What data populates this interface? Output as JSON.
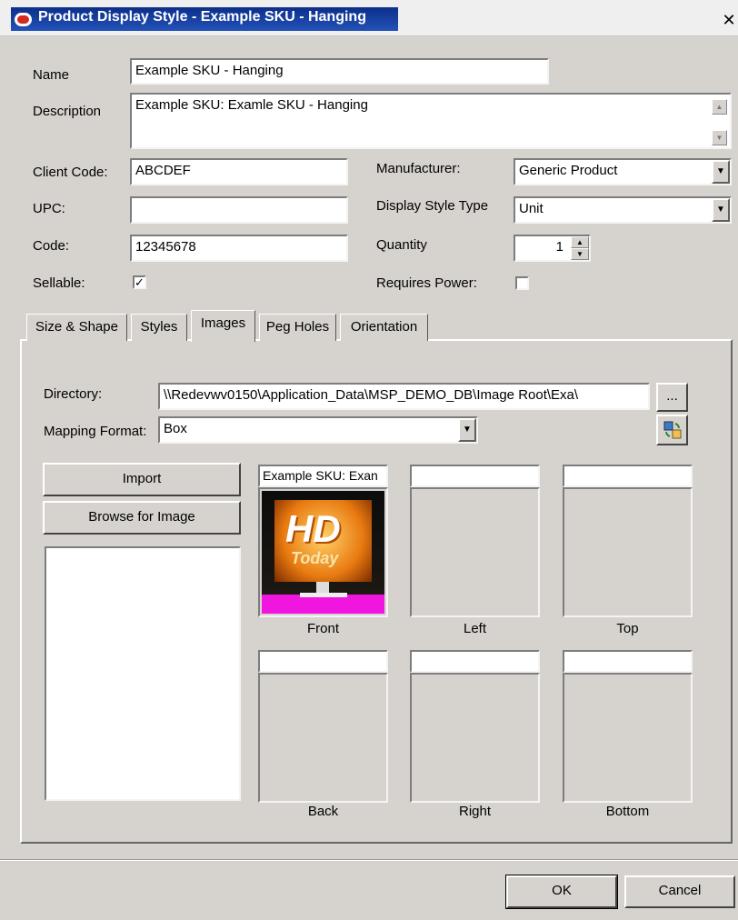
{
  "window": {
    "title": "Product Display Style - Example SKU - Hanging",
    "close_glyph": "✕"
  },
  "form": {
    "name_label": "Name",
    "name_value": "Example SKU - Hanging",
    "description_label": "Description",
    "description_value": "Example SKU: Examle SKU - Hanging",
    "client_code_label": "Client Code:",
    "client_code_value": "ABCDEF",
    "upc_label": "UPC:",
    "upc_value": "",
    "code_label": "Code:",
    "code_value": "12345678",
    "sellable_label": "Sellable:",
    "sellable_checked": true,
    "manufacturer_label": "Manufacturer:",
    "manufacturer_value": "Generic Product",
    "display_style_type_label": "Display Style Type",
    "display_style_type_value": "Unit",
    "quantity_label": "Quantity",
    "quantity_value": "1",
    "requires_power_label": "Requires Power:",
    "requires_power_checked": false
  },
  "tabs": [
    {
      "label": "Size & Shape"
    },
    {
      "label": "Styles"
    },
    {
      "label": "Images",
      "active": true
    },
    {
      "label": "Peg Holes"
    },
    {
      "label": "Orientation"
    }
  ],
  "images_tab": {
    "directory_label": "Directory:",
    "directory_value": "\\\\Redevwv0150\\Application_Data\\MSP_DEMO_DB\\Image Root\\Exa\\",
    "browse_dir_label": "...",
    "mapping_format_label": "Mapping Format:",
    "mapping_format_value": "Box",
    "import_label": "Import",
    "browse_image_label": "Browse for Image",
    "thumb_text_top": "HD",
    "thumb_text_bottom": "Today",
    "faces": [
      {
        "label": "Front",
        "caption": "Example SKU: Exan",
        "has_image": true
      },
      {
        "label": "Left",
        "caption": "",
        "has_image": false
      },
      {
        "label": "Top",
        "caption": "",
        "has_image": false
      },
      {
        "label": "Back",
        "caption": "",
        "has_image": false
      },
      {
        "label": "Right",
        "caption": "",
        "has_image": false
      },
      {
        "label": "Bottom",
        "caption": "",
        "has_image": false
      }
    ]
  },
  "buttons": {
    "ok_label": "OK",
    "cancel_label": "Cancel"
  },
  "colors": {
    "title_bar": "#0b2f8a",
    "dialog_bg": "#d6d3ce",
    "field_bg": "#ffffff"
  }
}
